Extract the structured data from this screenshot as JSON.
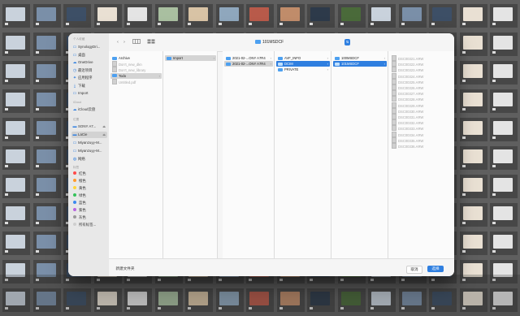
{
  "sidebar": {
    "groups": {
      "favorites": "个人收藏",
      "icloud": "iCloud",
      "locations": "位置",
      "tags": "标签"
    },
    "favorites": [
      {
        "label": "SynologyDri...",
        "icon": "folder-icon"
      },
      {
        "label": "桌面",
        "icon": "desktop-icon"
      },
      {
        "label": "OneDrive",
        "icon": "cloud-icon"
      },
      {
        "label": "最近项目",
        "icon": "clock-icon"
      },
      {
        "label": "应用程序",
        "icon": "apps-icon"
      },
      {
        "label": "下载",
        "icon": "download-icon"
      },
      {
        "label": "Import",
        "icon": "folder-icon"
      }
    ],
    "icloud": [
      {
        "label": "iCloud云盘",
        "icon": "cloud-icon"
      }
    ],
    "locations": [
      {
        "label": "SONY A7...",
        "icon": "drive-icon",
        "eject": true
      },
      {
        "label": "LaCie",
        "icon": "drive-icon",
        "eject": true,
        "selected": true
      },
      {
        "label": "Miyanzuyy-M...",
        "icon": "display-icon"
      },
      {
        "label": "Miyanzuyy-M...",
        "icon": "display-icon"
      },
      {
        "label": "网络",
        "icon": "globe-icon"
      }
    ],
    "tags": [
      {
        "label": "红色",
        "color": "#ff4a4a"
      },
      {
        "label": "橙色",
        "color": "#ff9a2e"
      },
      {
        "label": "黄色",
        "color": "#ffd43b"
      },
      {
        "label": "绿色",
        "color": "#35c25a"
      },
      {
        "label": "蓝色",
        "color": "#3b8af0"
      },
      {
        "label": "紫色",
        "color": "#b865e0"
      },
      {
        "label": "灰色",
        "color": "#9a9a9a"
      },
      {
        "label": "所有标签...",
        "color": "#cfcfcf"
      }
    ]
  },
  "toolbar": {
    "back": "‹",
    "forward": "›",
    "path": "101MSDCF",
    "path_arrows": "⇅"
  },
  "columns": {
    "col1": [
      {
        "label": "Archive",
        "kind": "folder"
      },
      {
        "label": "Don't_new_dkn",
        "kind": "doc",
        "dim": true
      },
      {
        "label": "Don't_new_library",
        "kind": "doc",
        "dim": true
      },
      {
        "label": "Todo",
        "kind": "folder",
        "state": "gsel",
        "arrow": true
      },
      {
        "label": "Untitled.pdf",
        "kind": "doc",
        "dim": true
      }
    ],
    "col2": [
      {
        "label": "Import",
        "kind": "folder",
        "state": "gsel",
        "arrow": true
      }
    ],
    "col3": [
      {
        "label": "2021-02-...ONY A7R4",
        "kind": "folder",
        "arrow": true
      },
      {
        "label": "2021-02-...ONY A7R4",
        "kind": "folder",
        "state": "gsel",
        "arrow": true
      }
    ],
    "col4": [
      {
        "label": "AVF_INFO",
        "kind": "folder",
        "arrow": true
      },
      {
        "label": "DCIM",
        "kind": "folder",
        "state": "sel",
        "arrow": true
      },
      {
        "label": "PRIVATE",
        "kind": "folder",
        "arrow": true
      }
    ],
    "col5": [
      {
        "label": "100MSDCF",
        "kind": "folder",
        "arrow": true
      },
      {
        "label": "101MSDCF",
        "kind": "folder",
        "state": "sel",
        "arrow": true
      }
    ],
    "col6": [
      {
        "label": "DSC00321.ARW",
        "kind": "doc",
        "dim": true
      },
      {
        "label": "DSC00322.ARW",
        "kind": "doc",
        "dim": true
      },
      {
        "label": "DSC00323.ARW",
        "kind": "doc",
        "dim": true
      },
      {
        "label": "DSC00324.ARW",
        "kind": "doc",
        "dim": true
      },
      {
        "label": "DSC00325.ARW",
        "kind": "doc",
        "dim": true
      },
      {
        "label": "DSC00326.ARW",
        "kind": "doc",
        "dim": true
      },
      {
        "label": "DSC00327.ARW",
        "kind": "doc",
        "dim": true
      },
      {
        "label": "DSC00328.ARW",
        "kind": "doc",
        "dim": true
      },
      {
        "label": "DSC00329.ARW",
        "kind": "doc",
        "dim": true
      },
      {
        "label": "DSC00330.ARW",
        "kind": "doc",
        "dim": true
      },
      {
        "label": "DSC00331.ARW",
        "kind": "doc",
        "dim": true
      },
      {
        "label": "DSC00332.ARW",
        "kind": "doc",
        "dim": true
      },
      {
        "label": "DSC00333.ARW",
        "kind": "doc",
        "dim": true
      },
      {
        "label": "DSC00334.ARW",
        "kind": "doc",
        "dim": true
      },
      {
        "label": "DSC00335.ARW",
        "kind": "doc",
        "dim": true
      },
      {
        "label": "DSC00336.ARW",
        "kind": "doc",
        "dim": true
      }
    ]
  },
  "footer": {
    "new_folder": "新建文件夹",
    "cancel": "取消",
    "choose": "选择"
  },
  "colors": {
    "accent": "#2f7fe0",
    "background": "#5f5f5f"
  }
}
